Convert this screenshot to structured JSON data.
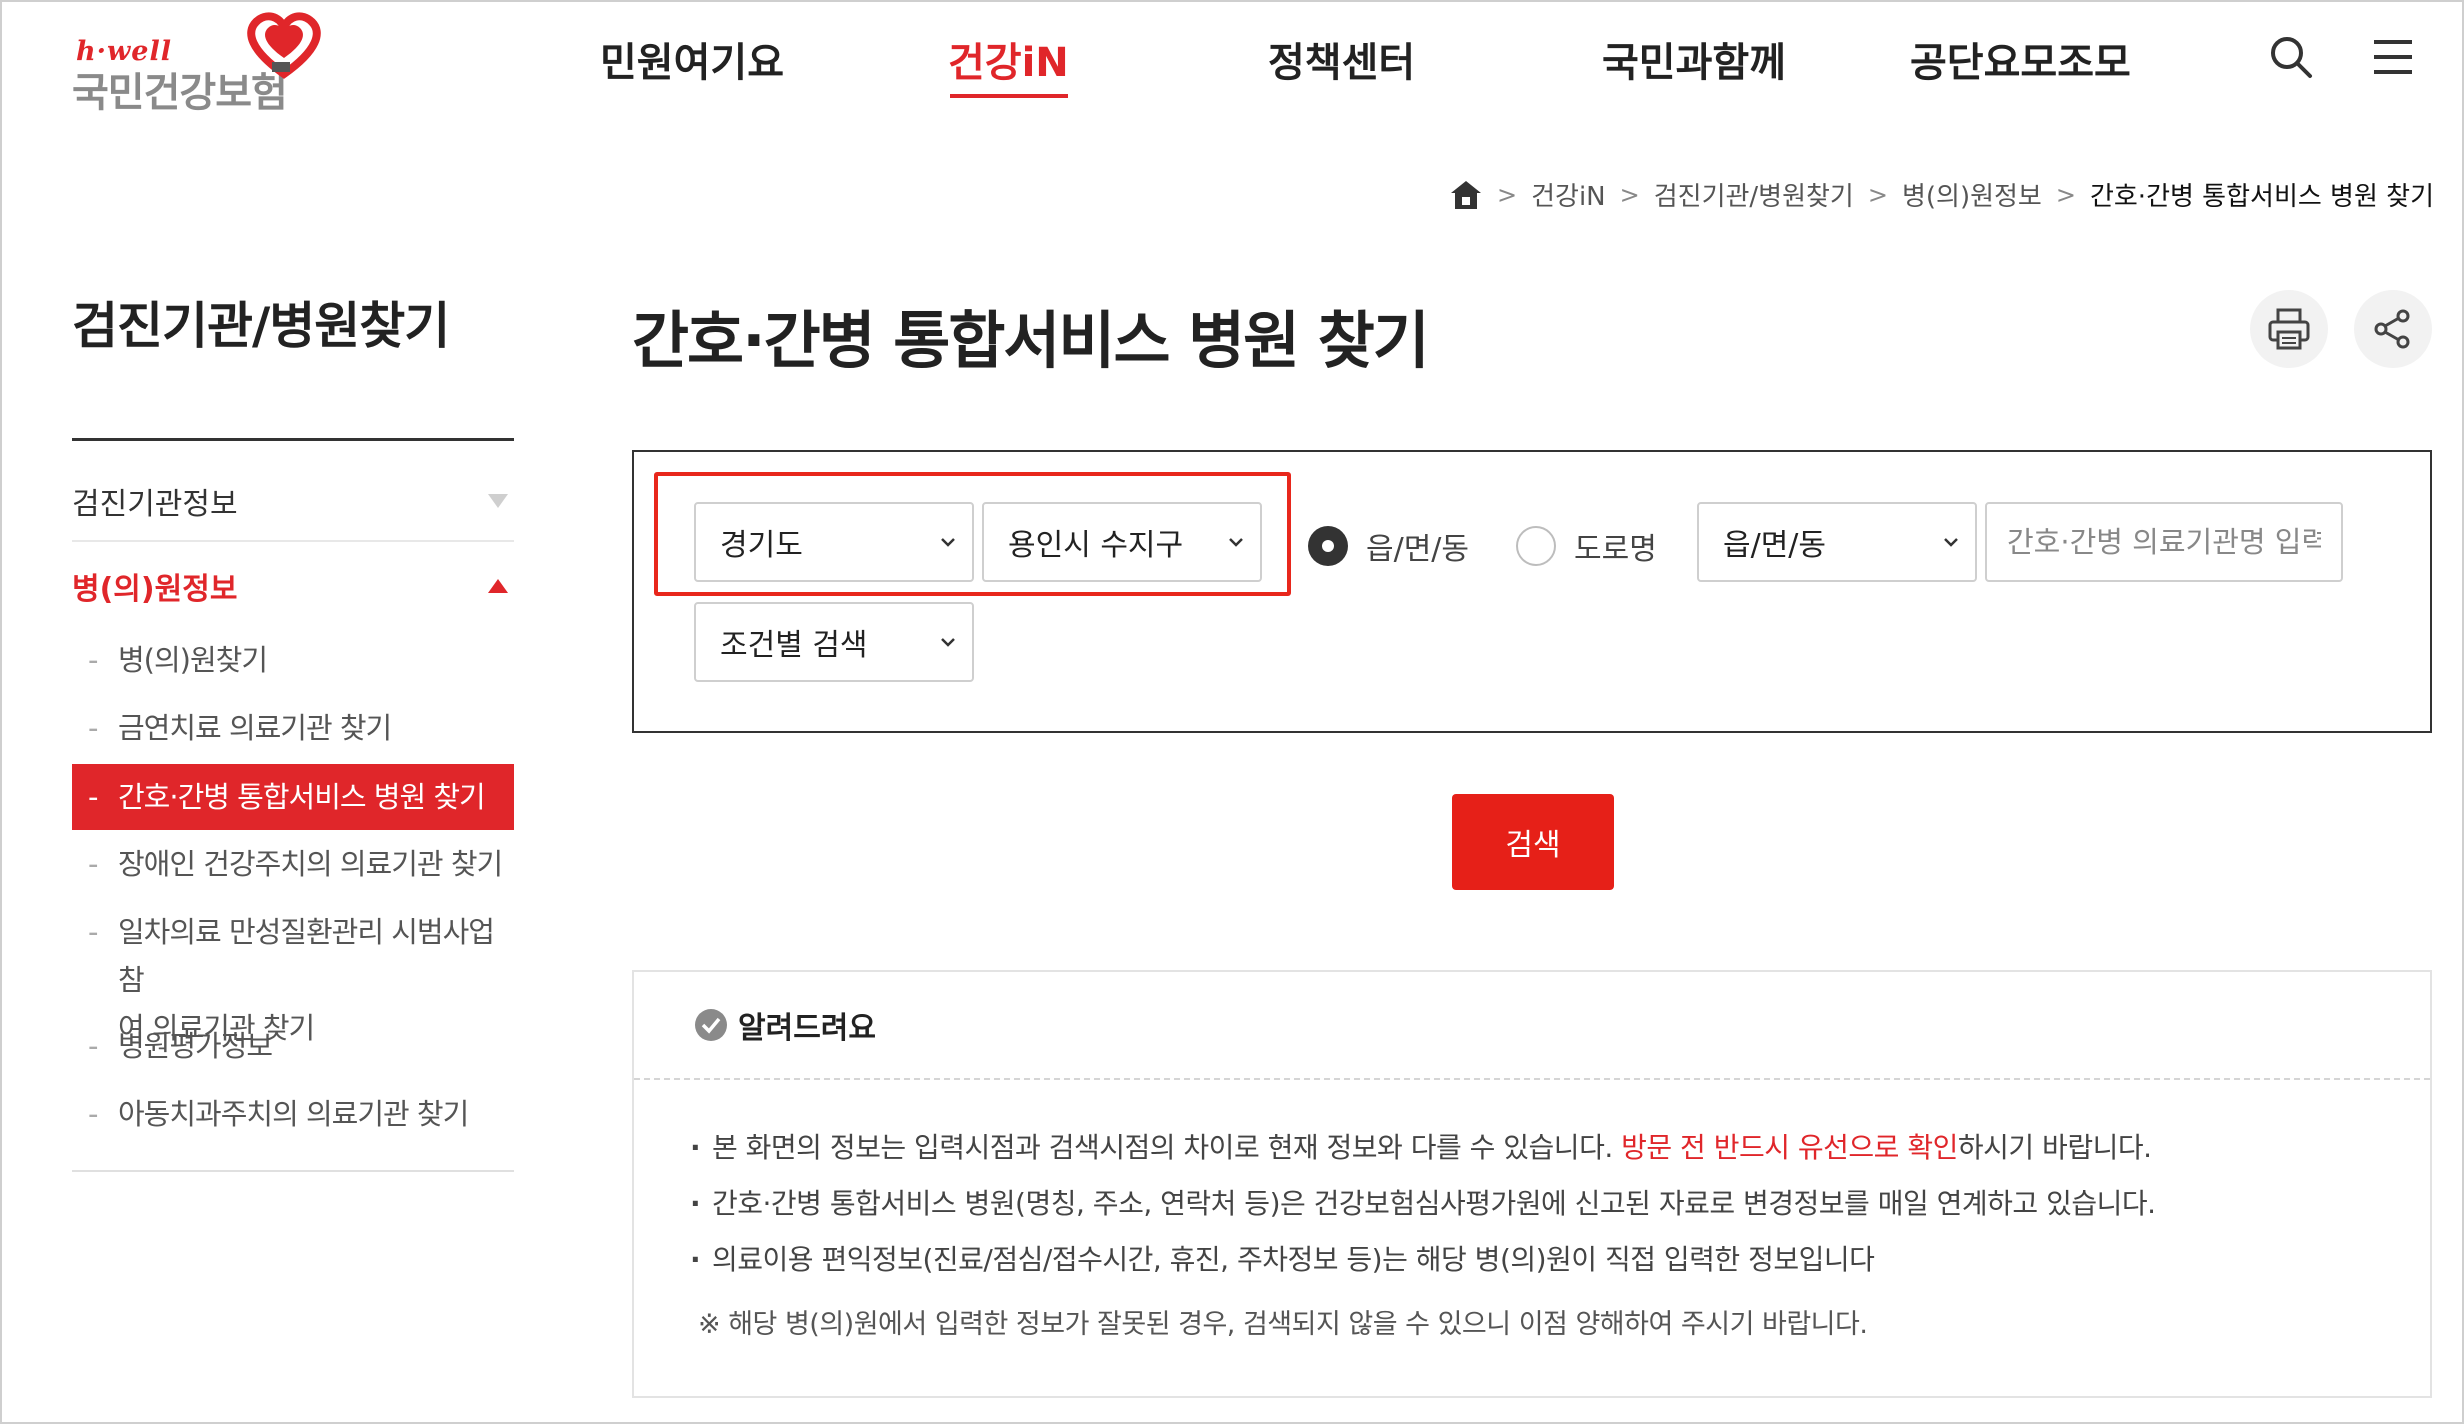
{
  "header": {
    "logo_sub": "h·well",
    "logo_main": "국민건강보험",
    "nav": [
      {
        "label": "민원여기요",
        "active": false
      },
      {
        "label": "건강iN",
        "active": true
      },
      {
        "label": "정책센터",
        "active": false
      },
      {
        "label": "국민과함께",
        "active": false
      },
      {
        "label": "공단요모조모",
        "active": false
      }
    ],
    "icons": [
      "search-icon",
      "hamburger-menu-icon"
    ],
    "brand_color": "#e0262a"
  },
  "breadcrumb": {
    "items": [
      "건강iN",
      "검진기관/병원찾기",
      "병(의)원정보"
    ],
    "current": "간호·간병 통합서비스 병원 찾기"
  },
  "sidebar": {
    "title": "검진기관/병원찾기",
    "categories": [
      {
        "label": "검진기관정보",
        "expanded": false
      },
      {
        "label": "병(의)원정보",
        "expanded": true
      }
    ],
    "sub_items": [
      {
        "label": "병(의)원찾기",
        "active": false
      },
      {
        "label": "금연치료 의료기관 찾기",
        "active": false
      },
      {
        "label": "간호·간병 통합서비스 병원 찾기",
        "active": true
      },
      {
        "label": "장애인 건강주치의 의료기관 찾기",
        "active": false
      },
      {
        "label": "일차의료 만성질환관리 시범사업 참",
        "label_line2": "여 의료기관 찾기",
        "active": false
      },
      {
        "label": "병원평가정보",
        "active": false
      },
      {
        "label": "아동치과주치의 의료기관 찾기",
        "active": false
      }
    ]
  },
  "main": {
    "title": "간호·간병 통합서비스 병원 찾기",
    "action_icons": [
      "print-icon",
      "share-icon"
    ]
  },
  "search": {
    "province": "경기도",
    "district": "용인시 수지구",
    "radio_options": [
      {
        "label": "읍/면/동",
        "selected": true
      },
      {
        "label": "도로명",
        "selected": false
      }
    ],
    "dong_select": "읍/면/동",
    "name_placeholder": "간호·간병 의료기관명 입력",
    "condition_select": "조건별 검색",
    "button_label": "검색",
    "button_color": "#e62018"
  },
  "notice": {
    "title": "알려드려요",
    "item1_a": "본 화면의 정보는 입력시점과 검색시점의 차이로 현재 정보와 다를 수 있습니다. ",
    "item1_red": "방문 전 반드시 유선으로 확인",
    "item1_b": "하시기 바랍니다.",
    "item2": "간호·간병 통합서비스 병원(명칭, 주소, 연락처 등)은 건강보험심사평가원에 신고된 자료로 변경정보를 매일 연계하고 있습니다.",
    "item3": "의료이용 편익정보(진료/점심/접수시간, 휴진, 주차정보 등)는 해당 병(의)원이 직접 입력한 정보입니다",
    "note": "※ 해당 병(의)원에서 입력한 정보가 잘못된 경우, 검색되지 않을 수 있으니 이점 양해하여 주시기 바랍니다."
  }
}
